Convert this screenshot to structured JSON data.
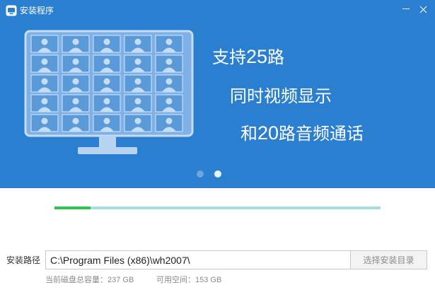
{
  "window": {
    "title": "安装程序",
    "minimize_icon": "minimize-icon",
    "close_icon": "close-icon",
    "app_icon": "installer-app-icon"
  },
  "banner": {
    "background_color": "#2b7fd0",
    "illustration": "monitor-video-grid-icon",
    "grid": {
      "rows": 5,
      "cols": 5
    },
    "slogan": {
      "line1": {
        "prefix": "支持",
        "number": "25",
        "suffix": "路"
      },
      "line2": {
        "text": "同时视频显示"
      },
      "line3": {
        "prefix": "和",
        "number": "20",
        "suffix": "路音频通话"
      }
    },
    "carousel": {
      "count": 2,
      "active_index": 2
    }
  },
  "progress": {
    "fraction": 0.11,
    "fill_color": "#2ec452",
    "track_color": "#a6dbe0"
  },
  "install": {
    "path_label": "安装路径",
    "path_value": "C:\\Program Files (x86)\\wh2007\\",
    "browse_button": "选择安装目录",
    "disk_total_label": "当前磁盘总容量：",
    "disk_total_value": "237 GB",
    "disk_free_label": "可用空间：",
    "disk_free_value": "153 GB"
  }
}
